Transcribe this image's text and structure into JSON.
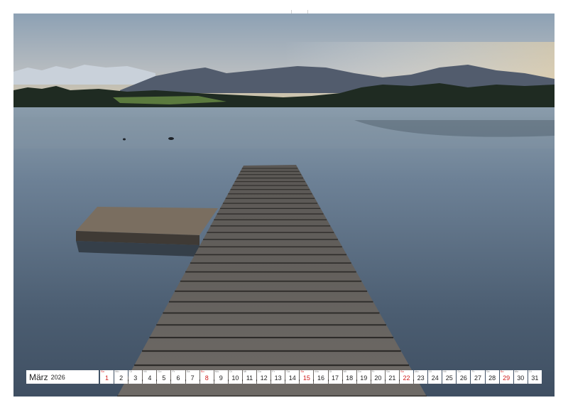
{
  "calendar": {
    "month": "März",
    "year": "2026",
    "days": [
      {
        "wd": "So",
        "num": "1",
        "sunday": true
      },
      {
        "wd": "Mo",
        "num": "2",
        "sunday": false
      },
      {
        "wd": "Di",
        "num": "3",
        "sunday": false
      },
      {
        "wd": "Mi",
        "num": "4",
        "sunday": false
      },
      {
        "wd": "Do",
        "num": "5",
        "sunday": false
      },
      {
        "wd": "Fr",
        "num": "6",
        "sunday": false
      },
      {
        "wd": "Sa",
        "num": "7",
        "sunday": false
      },
      {
        "wd": "So",
        "num": "8",
        "sunday": true
      },
      {
        "wd": "Mo",
        "num": "9",
        "sunday": false
      },
      {
        "wd": "Di",
        "num": "10",
        "sunday": false
      },
      {
        "wd": "Mi",
        "num": "11",
        "sunday": false
      },
      {
        "wd": "Do",
        "num": "12",
        "sunday": false
      },
      {
        "wd": "Fr",
        "num": "13",
        "sunday": false
      },
      {
        "wd": "Sa",
        "num": "14",
        "sunday": false
      },
      {
        "wd": "So",
        "num": "15",
        "sunday": true
      },
      {
        "wd": "Mo",
        "num": "16",
        "sunday": false
      },
      {
        "wd": "Di",
        "num": "17",
        "sunday": false
      },
      {
        "wd": "Mi",
        "num": "18",
        "sunday": false
      },
      {
        "wd": "Do",
        "num": "19",
        "sunday": false
      },
      {
        "wd": "Fr",
        "num": "20",
        "sunday": false
      },
      {
        "wd": "Sa",
        "num": "21",
        "sunday": false
      },
      {
        "wd": "So",
        "num": "22",
        "sunday": true
      },
      {
        "wd": "Mo",
        "num": "23",
        "sunday": false
      },
      {
        "wd": "Di",
        "num": "24",
        "sunday": false
      },
      {
        "wd": "Mi",
        "num": "25",
        "sunday": false
      },
      {
        "wd": "Do",
        "num": "26",
        "sunday": false
      },
      {
        "wd": "Fr",
        "num": "27",
        "sunday": false
      },
      {
        "wd": "Sa",
        "num": "28",
        "sunday": false
      },
      {
        "wd": "So",
        "num": "29",
        "sunday": true
      },
      {
        "wd": "Mo",
        "num": "30",
        "sunday": false
      },
      {
        "wd": "Di",
        "num": "31",
        "sunday": false
      }
    ]
  },
  "colors": {
    "sunday": "#d01c1c",
    "sky_top": "#8fa3b6",
    "sky_bottom": "#d9c9a6",
    "water": "#4d5f73"
  }
}
